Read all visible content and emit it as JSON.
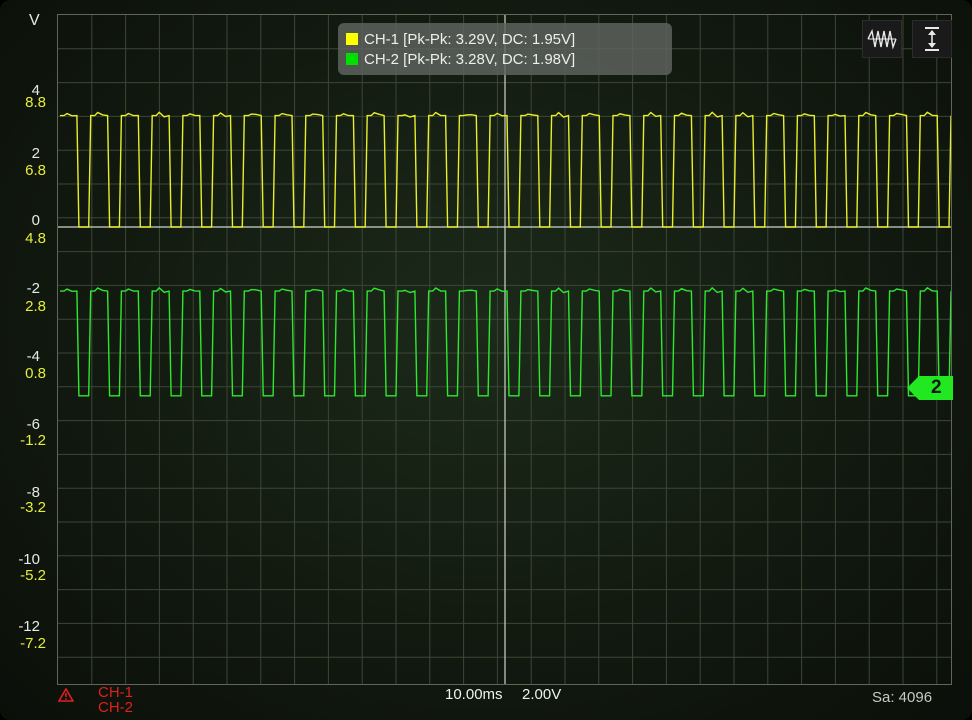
{
  "window": {
    "unit_label": "V",
    "sample_label": "Sa: 4096"
  },
  "legend": {
    "ch1": {
      "label": "CH-1 [Pk-Pk: 3.29V, DC: 1.95V]",
      "color": "#ffff00"
    },
    "ch2": {
      "label": "CH-2 [Pk-Pk: 3.28V, DC: 1.98V]",
      "color": "#00e000"
    }
  },
  "toolbar": {
    "waveform_icon": "waveform-icon",
    "vertical_scale_icon": "vertical-range-icon"
  },
  "axis": {
    "ch1_ticks": [
      "4",
      "2",
      "0",
      "-2",
      "-4",
      "-6",
      "-8",
      "-10",
      "-12"
    ],
    "ch2_ticks": [
      "8.8",
      "6.8",
      "4.8",
      "2.8",
      "0.8",
      "-1.2",
      "-3.2",
      "-5.2",
      "-7.2"
    ]
  },
  "status": {
    "warning_icon": "warning-icon",
    "trigger_channels": [
      "CH-1",
      "CH-2"
    ],
    "timebase": "10.00ms",
    "volts_per_div": "2.00V"
  },
  "ch2_marker": {
    "label": "2"
  },
  "chart_data": {
    "type": "line",
    "xlabel": "",
    "ylabel": "V",
    "grid": true,
    "timebase": "10.00ms",
    "series": [
      {
        "name": "CH-1",
        "color": "#e8ee2a",
        "low": 0.0,
        "high": 3.3,
        "pulses": 29
      },
      {
        "name": "CH-2",
        "color": "#2ee82e",
        "low": -5.0,
        "high": -1.9,
        "pulses": 29
      }
    ]
  }
}
